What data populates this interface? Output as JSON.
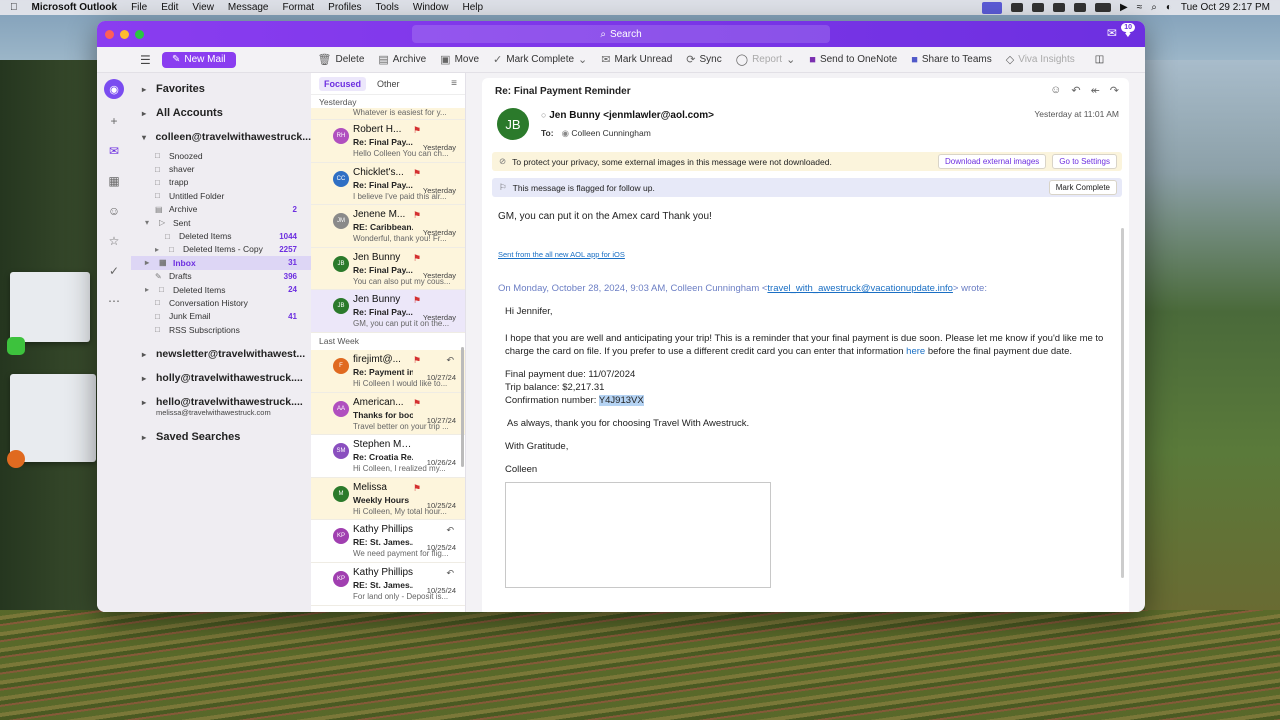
{
  "menubar": {
    "app": "Microsoft Outlook",
    "items": [
      "File",
      "Edit",
      "View",
      "Message",
      "Format",
      "Profiles",
      "Tools",
      "Window",
      "Help"
    ],
    "clock": "Tue Oct 29  2:17 PM"
  },
  "titlebar": {
    "search_placeholder": "Search",
    "notification_count": "10"
  },
  "toolbar": {
    "new_mail": "New Mail",
    "delete": "Delete",
    "archive": "Archive",
    "move": "Move",
    "mark_complete": "Mark Complete",
    "mark_unread": "Mark Unread",
    "sync": "Sync",
    "report": "Report",
    "send_onenote": "Send to OneNote",
    "share_teams": "Share to Teams",
    "viva": "Viva Insights"
  },
  "folders": {
    "favorites": "Favorites",
    "all_accounts": "All Accounts",
    "account": "colleen@travelwithawestruck...",
    "items": [
      {
        "label": "Snoozed",
        "count": ""
      },
      {
        "label": "shaver",
        "count": ""
      },
      {
        "label": "trapp",
        "count": ""
      },
      {
        "label": "Untitled Folder",
        "count": ""
      },
      {
        "label": "Archive",
        "count": "2"
      },
      {
        "label": "Sent",
        "count": ""
      },
      {
        "label": "Deleted Items",
        "count": "1044"
      },
      {
        "label": "Deleted Items - Copy",
        "count": "2257"
      },
      {
        "label": "Inbox",
        "count": "31"
      },
      {
        "label": "Drafts",
        "count": "396"
      },
      {
        "label": "Deleted Items",
        "count": "24"
      },
      {
        "label": "Conversation History",
        "count": ""
      },
      {
        "label": "Junk Email",
        "count": "41"
      },
      {
        "label": "RSS Subscriptions",
        "count": ""
      }
    ],
    "accounts": [
      {
        "label": "newsletter@travelwithawest...",
        "sub": ""
      },
      {
        "label": "holly@travelwithawestruck....",
        "sub": ""
      },
      {
        "label": "hello@travelwithawestruck....",
        "sub": "melissa@travelwithawestruck.com"
      }
    ],
    "saved_searches": "Saved Searches"
  },
  "list": {
    "tab_focused": "Focused",
    "tab_other": "Other",
    "sec_yesterday": "Yesterday",
    "first_preview": "Whatever is easiest for y...",
    "sec_lastweek": "Last Week",
    "yesterday_msgs": [
      {
        "initials": "RH",
        "color": "#b04fbf",
        "sender": "Robert H...",
        "subject": "Re: Final Pay...",
        "preview": "Hello Colleen You can ch...",
        "date": "Yesterday",
        "flag": true,
        "reply": false
      },
      {
        "initials": "CC",
        "color": "#2f6fc4",
        "sender": "Chicklet's...",
        "subject": "Re: Final Pay...",
        "preview": "I believe I've paid this alr...",
        "date": "Yesterday",
        "flag": true,
        "reply": false
      },
      {
        "initials": "JM",
        "color": "#8a8a8a",
        "sender": "Jenene M...",
        "subject": "RE: Caribbean...",
        "preview": "Wonderful, thank you! Fr...",
        "date": "Yesterday",
        "flag": true,
        "reply": false
      },
      {
        "initials": "JB",
        "color": "#2b7a2b",
        "sender": "Jen Bunny",
        "subject": "Re: Final Pay...",
        "preview": "You can also put my cous...",
        "date": "Yesterday",
        "flag": true,
        "reply": false
      },
      {
        "initials": "JB",
        "color": "#2b7a2b",
        "sender": "Jen Bunny",
        "subject": "Re: Final Pay...",
        "preview": "GM, you can put it on the...",
        "date": "Yesterday",
        "flag": true,
        "reply": false,
        "selected": true
      }
    ],
    "lastweek_msgs": [
      {
        "initials": "F",
        "color": "#e06a20",
        "sender": "firejimt@...",
        "subject": "Re: Payment in...",
        "preview": "Hi Colleen I would like to...",
        "date": "10/27/24",
        "flag": true,
        "reply": true
      },
      {
        "initials": "AA",
        "color": "#b04fbf",
        "sender": "American...",
        "subject": "Thanks for boo...",
        "preview": "Travel better on your trip ...",
        "date": "10/27/24",
        "flag": true,
        "reply": false
      },
      {
        "initials": "SM",
        "color": "#8a4fbf",
        "sender": "Stephen Molldrem",
        "subject": "Re: Croatia Re...",
        "preview": "Hi Colleen, I realized my...",
        "date": "10/26/24",
        "flag": false,
        "reply": false
      },
      {
        "initials": "M",
        "color": "#2b7a2b",
        "sender": "Melissa",
        "subject": "Weekly Hours",
        "preview": "Hi Colleen, My total hour...",
        "date": "10/25/24",
        "flag": true,
        "reply": false
      },
      {
        "initials": "KP",
        "color": "#a03fb0",
        "sender": "Kathy Phillips",
        "subject": "RE: St. James...",
        "preview": "We need payment for flig...",
        "date": "10/25/24",
        "flag": false,
        "reply": true
      },
      {
        "initials": "KP",
        "color": "#a03fb0",
        "sender": "Kathy Phillips",
        "subject": "RE: St. James...",
        "preview": "For land only - Deposit is...",
        "date": "10/25/24",
        "flag": false,
        "reply": true
      }
    ]
  },
  "reading": {
    "subject": "Re: Final Payment Reminder",
    "avatar": "JB",
    "from": "Jen Bunny <jenmlawler@aol.com>",
    "to_label": "To:",
    "to": "Colleen Cunningham",
    "date": "Yesterday at 11:01 AM",
    "privacy_msg": "To protect your privacy, some external images in this message were not downloaded.",
    "download_btn": "Download external images",
    "settings_btn": "Go to Settings",
    "flag_msg": "This message is flagged for follow up.",
    "mark_complete_btn": "Mark Complete",
    "reply_text": "GM, you can put it on the Amex card Thank you!",
    "sent_from": "Sent from the all new AOL app for iOS",
    "on_prefix": "On Monday, October 28, 2024, 9:03 AM, Colleen Cunningham <",
    "on_email": "travel_with_awestruck@vacationupdate.info",
    "on_suffix": "> wrote:",
    "greeting": "Hi Jennifer,",
    "para1_a": "I hope that you are well and anticipating your trip! This is a reminder that your final payment is due soon. Please let me know if you'd like me to charge the card on file. If you prefer to use a different credit card you can enter that information ",
    "para1_link": "here",
    "para1_b": " before the final payment due date.",
    "due": "Final payment due: 11/07/2024",
    "balance": "Trip balance: $2,217.31",
    "conf_label": "Confirmation number: ",
    "conf_num": "Y4J913VX",
    "thanks": "As always, thank you for choosing Travel With Awestruck.",
    "closing": "With Gratitude,",
    "signature": "Colleen"
  }
}
